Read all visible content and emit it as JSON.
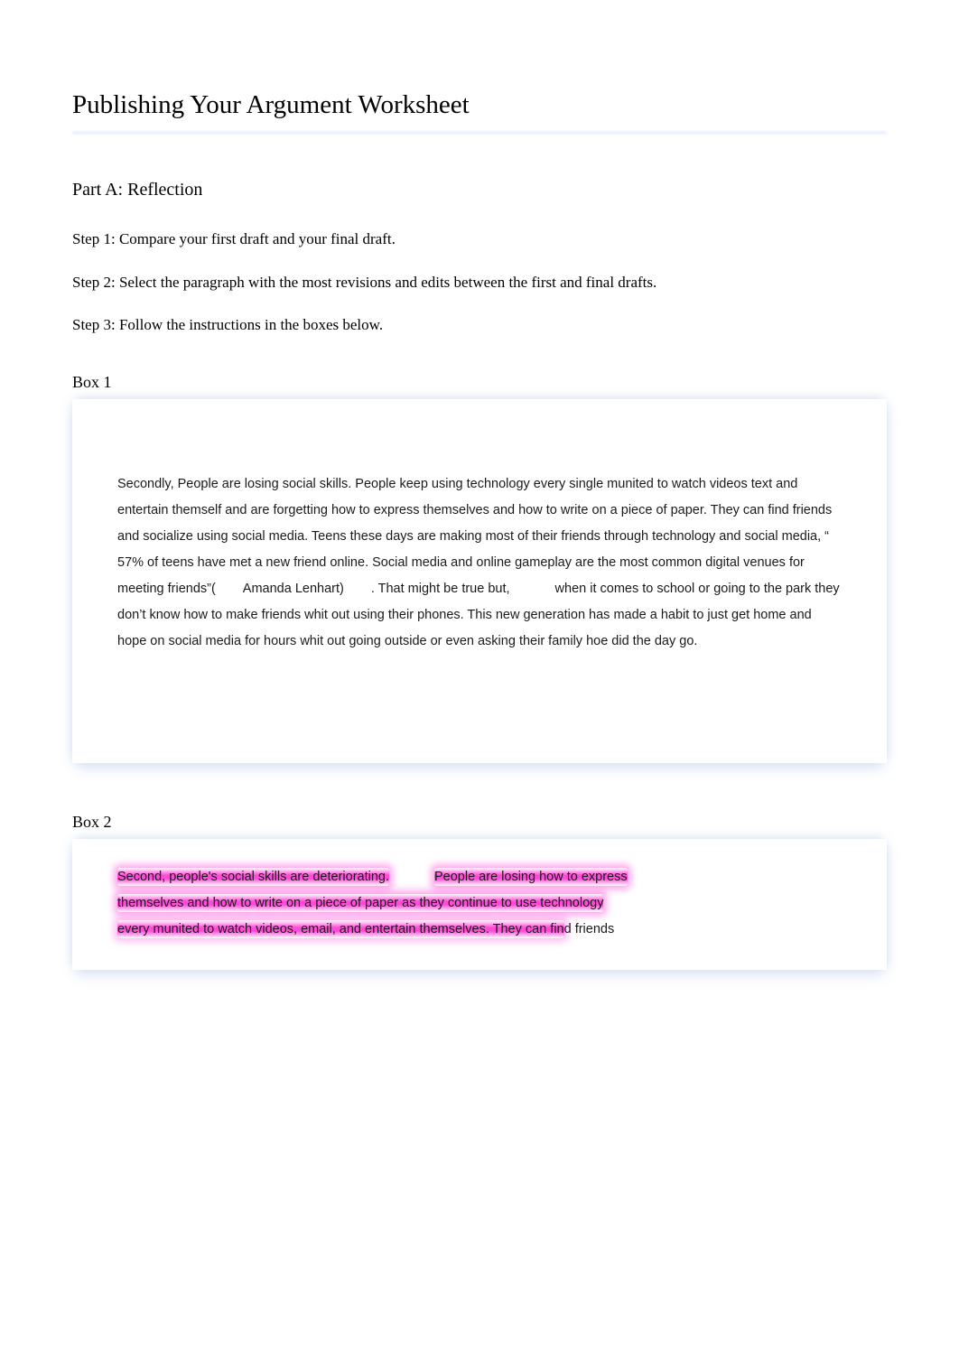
{
  "title": "Publishing Your Argument Worksheet",
  "partA": {
    "heading": "Part A: Reflection",
    "steps": [
      "Step 1: Compare your first draft and your final draft.",
      "Step 2: Select the paragraph with the most revisions and edits between the first and final drafts.",
      "Step 3: Follow the instructions in the boxes below."
    ]
  },
  "box1": {
    "heading": "Box 1",
    "text_part1": "Secondly, People are losing social skills. People keep using technology every single munited to watch videos text and entertain themself and are forgetting how to express themselves and how to write on a piece of paper. They can find friends and socialize using social media. Teens these days are making most of their friends through technology and social media, “ 57% of teens have met a new friend online. Social media and online gameplay are the most common digital venues for meeting friends”(",
    "text_citation": "Amanda Lenhart)",
    "text_part2a": ". That might be true but,",
    "text_part2b": "when it comes to school or going to the park they don’t know how to make friends whit out using their phones. This new generation has made a habit to just get home and hope on social media for hours whit out going outside or even asking their family hoe did the day go."
  },
  "box2": {
    "heading": "Box 2",
    "segment1": "Second, people's social skills are deteriorating.",
    "segment2": "People are losing how to express",
    "segment3": "themselves and how to write on a piece of paper as they continue to use technology",
    "segment4": "every munited to watch videos, email, and entertain themselves. They can fin",
    "segment4_plain": "d friends"
  }
}
